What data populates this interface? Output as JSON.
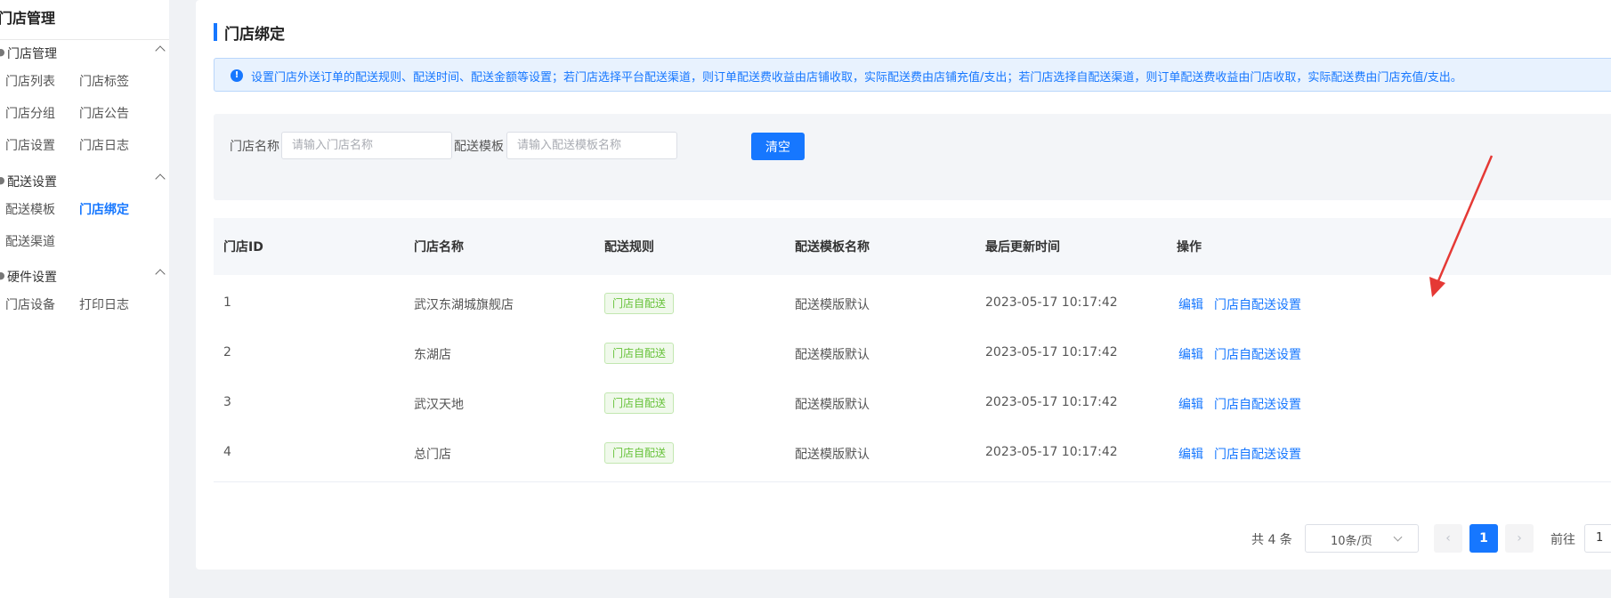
{
  "sidebar": {
    "title": "门店管理",
    "groups": [
      {
        "label": "门店管理",
        "icon": "store-icon",
        "items": [
          "门店列表",
          "门店标签",
          "门店分组",
          "门店公告",
          "门店设置",
          "门店日志"
        ]
      },
      {
        "label": "配送设置",
        "icon": "delivery-icon",
        "items": [
          "配送模板",
          "门店绑定",
          "配送渠道"
        ]
      },
      {
        "label": "硬件设置",
        "icon": "hardware-icon",
        "items": [
          "门店设备",
          "打印日志"
        ]
      }
    ],
    "active_item": "门店绑定"
  },
  "page": {
    "title": "门店绑定",
    "notice": "设置门店外送订单的配送规则、配送时间、配送金额等设置；若门店选择平台配送渠道，则订单配送费收益由店铺收取，实际配送费由店铺充值/支出；若门店选择自配送渠道，则订单配送费收益由门店收取，实际配送费由门店充值/支出。"
  },
  "filter": {
    "store_name_label": "门店名称",
    "store_name_placeholder": "请输入门店名称",
    "template_label": "配送模板",
    "template_placeholder": "请输入配送模板名称",
    "clear_label": "清空"
  },
  "table": {
    "columns": [
      "门店ID",
      "门店名称",
      "配送规则",
      "配送模板名称",
      "最后更新时间",
      "操作"
    ],
    "rows": [
      {
        "id": "1",
        "name": "武汉东湖城旗舰店",
        "rule": "门店自配送",
        "template": "配送模版默认",
        "updated": "2023-05-17 10:17:42",
        "edit": "编辑",
        "setting": "门店自配送设置"
      },
      {
        "id": "2",
        "name": "东湖店",
        "rule": "门店自配送",
        "template": "配送模版默认",
        "updated": "2023-05-17 10:17:42",
        "edit": "编辑",
        "setting": "门店自配送设置"
      },
      {
        "id": "3",
        "name": "武汉天地",
        "rule": "门店自配送",
        "template": "配送模版默认",
        "updated": "2023-05-17 10:17:42",
        "edit": "编辑",
        "setting": "门店自配送设置"
      },
      {
        "id": "4",
        "name": "总门店",
        "rule": "门店自配送",
        "template": "配送模版默认",
        "updated": "2023-05-17 10:17:42",
        "edit": "编辑",
        "setting": "门店自配送设置"
      }
    ]
  },
  "pagination": {
    "total": "共 4 条",
    "page_size": "10条/页",
    "current_page": "1",
    "goto_label": "前往",
    "goto_value": "1"
  },
  "colors": {
    "primary": "#1677ff",
    "success_tag": "#67c23a",
    "annotation_arrow": "#e53935"
  }
}
